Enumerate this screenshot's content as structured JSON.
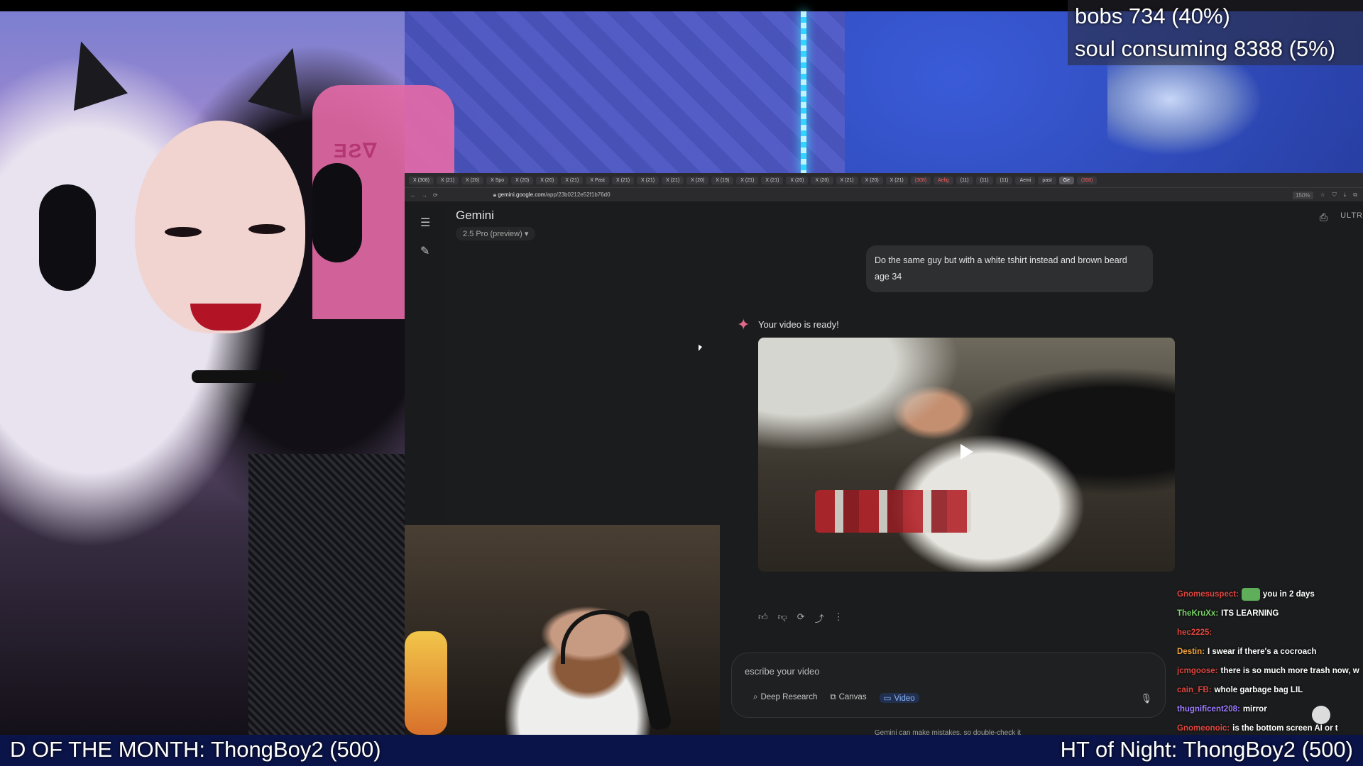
{
  "overlay": {
    "goals": [
      "bobs 734 (40%)",
      "soul consuming  8388 (5%)"
    ],
    "bottom_left": "D OF THE MONTH: ThongBoy2 (500)",
    "bottom_right": "HT of Night: ThongBoy2 (500)"
  },
  "browser": {
    "url_host": "gemini.google.com",
    "url_path": "/app/23b0212e52f1b76d0",
    "zoom": "150%",
    "tabs": [
      "X (308)",
      "X (21)",
      "X (20)",
      "X Spo",
      "X (20)",
      "X (20)",
      "X (21)",
      "X Past",
      "X (21)",
      "X (21)",
      "X (21)",
      "X (20)",
      "X (19)",
      "X (21)",
      "X (21)",
      "X (20)",
      "X (20)",
      "X (21)",
      "X (20)",
      "X (21)",
      "(308)",
      "Aelig",
      "(11)",
      "(11)",
      "(11)",
      "Aemi",
      "past",
      "Ge",
      "(308)"
    ]
  },
  "gemini": {
    "title": "Gemini",
    "model": "2.5 Pro (preview)",
    "plan": "ULTR",
    "user_message": "Do the same guy but with a white tshirt instead and brown beard age 34",
    "response_text": "Your video is ready!",
    "prompt_placeholder": "escribe your video",
    "tools": [
      {
        "label": "Deep Research",
        "icon": "deep-research-icon",
        "glyph": "⌕"
      },
      {
        "label": "Canvas",
        "icon": "canvas-icon",
        "glyph": "⧉"
      },
      {
        "label": "Video",
        "icon": "video-icon",
        "glyph": "▭"
      }
    ],
    "disclaimer": "Gemini can make mistakes, so double-check it"
  },
  "chat": [
    {
      "user": "Gnomesuspect:",
      "color": "#e0463f",
      "emote": "frog",
      "message": "you in 2 days"
    },
    {
      "user": "TheKruXx:",
      "color": "#7cd46a",
      "emote": "",
      "message": "ITS LEARNING"
    },
    {
      "user": "hec2225:",
      "color": "#e0463f",
      "emote": "face",
      "message": ""
    },
    {
      "user": "Destin:",
      "color": "#f2a23a",
      "emote": "",
      "message": "I swear if there's a cocroach"
    },
    {
      "user": "jcmgoose:",
      "color": "#e0463f",
      "emote": "",
      "message": "there is so much more trash now, w"
    },
    {
      "user": "cain_FB:",
      "color": "#e0463f",
      "emote": "",
      "message": "whole garbage bag LIL"
    },
    {
      "user": "thugnificent208:",
      "color": "#9b7bff",
      "emote": "",
      "message": "mirror"
    },
    {
      "user": "Gnomeonoic:",
      "color": "#e0463f",
      "emote": "",
      "message": "is the bottom screen AI  or t"
    }
  ]
}
